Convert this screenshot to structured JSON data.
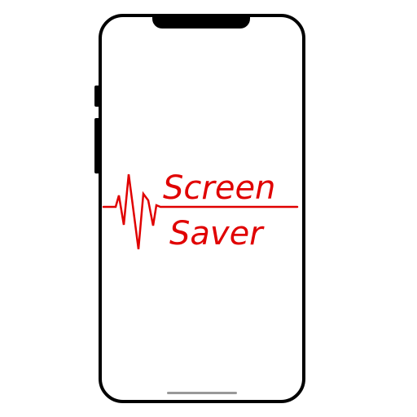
{
  "logo": {
    "line1": "Screen",
    "line2": "Saver",
    "color": "#e00000"
  },
  "device": {
    "frame_color": "#000000",
    "screen_color": "#ffffff"
  }
}
